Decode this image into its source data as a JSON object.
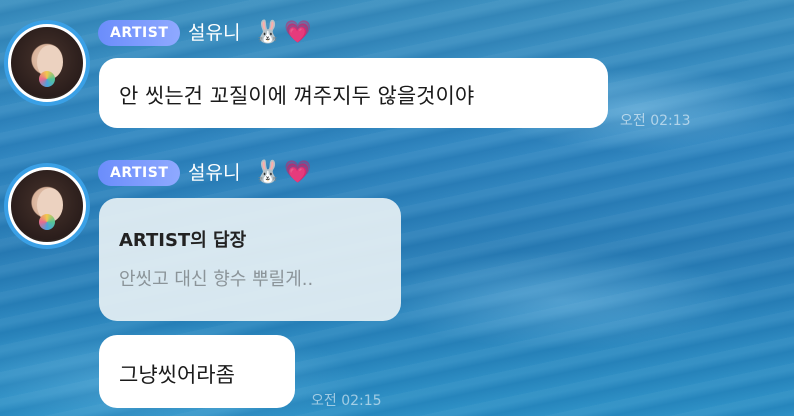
{
  "messages": [
    {
      "badge": "ARTIST",
      "sender": "설유니",
      "emoji1": "🐰",
      "emoji2": "💗",
      "text": "안 씻는건 꼬질이에 껴주지두 않을것이야",
      "time": "오전 02:13"
    },
    {
      "badge": "ARTIST",
      "sender": "설유니",
      "emoji1": "🐰",
      "emoji2": "💗",
      "reply": {
        "title": "ARTIST의 답장",
        "quoted": "안씻고 대신 향수 뿌릴게.."
      },
      "text": "그냥씻어라좀",
      "time": "오전 02:15"
    }
  ]
}
